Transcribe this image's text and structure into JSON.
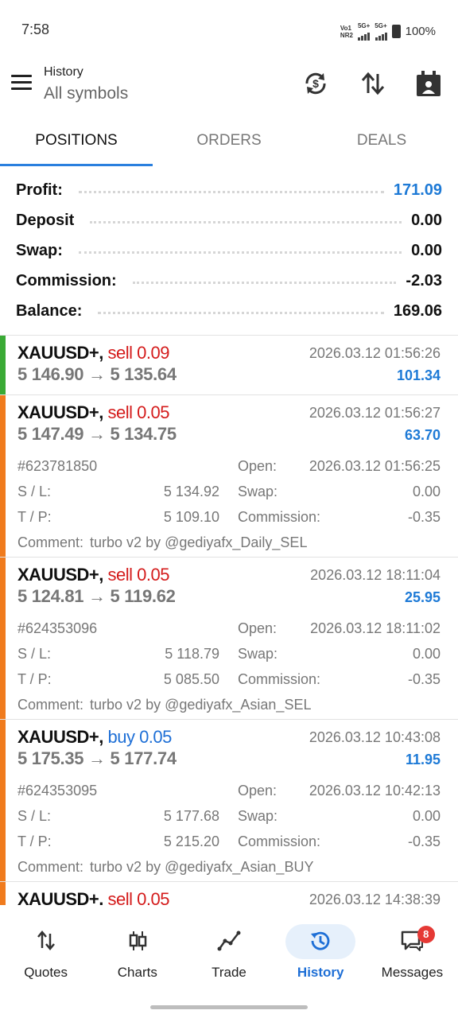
{
  "status_bar": {
    "time": "7:58",
    "net1_top": "Vo1",
    "net1_bottom": "NR2",
    "net2": "5G+",
    "net3": "5G+",
    "battery": "100%"
  },
  "app_bar": {
    "title": "History",
    "subtitle": "All symbols",
    "icons": [
      "menu-icon",
      "currency-refresh-icon",
      "sort-icon",
      "calendar-icon"
    ]
  },
  "tabs": [
    {
      "label": "POSITIONS",
      "active": true
    },
    {
      "label": "ORDERS",
      "active": false
    },
    {
      "label": "DEALS",
      "active": false
    }
  ],
  "summary": [
    {
      "label": "Profit:",
      "value": "171.09"
    },
    {
      "label": "Deposit",
      "value": "0.00"
    },
    {
      "label": "Swap:",
      "value": "0.00"
    },
    {
      "label": "Commission:",
      "value": "-2.03"
    },
    {
      "label": "Balance:",
      "value": "169.06"
    }
  ],
  "colors": {
    "profit_blue": "#1e7ad6",
    "sell_red": "#d41b1b",
    "buy_blue": "#1e6fd6",
    "stripe_green": "#3aaa35",
    "stripe_orange": "#f07b1d"
  },
  "positions": [
    {
      "symbol": "XAUUSD+,",
      "side": "sell 0.09",
      "time": "2026.03.12 01:56:26",
      "prices": "5 146.90 → 5 135.64",
      "profit": "101.34"
    },
    {
      "symbol": "XAUUSD+,",
      "side": "sell 0.05",
      "time": "2026.03.12 01:56:27",
      "prices": "5 147.49 → 5 134.75",
      "profit": "63.70",
      "ticket": "#623781850",
      "open_label": "Open:",
      "open": "2026.03.12 01:56:25",
      "sl_label": "S / L:",
      "sl": "5 134.92",
      "swap_label": "Swap:",
      "swap": "0.00",
      "tp_label": "T / P:",
      "tp": "5 109.10",
      "comm_label": "Commission:",
      "commission": "-0.35",
      "comment_label": "Comment:",
      "comment": "turbo v2 by @gediyafx_Daily_SEL"
    },
    {
      "symbol": "XAUUSD+,",
      "side": "sell 0.05",
      "time": "2026.03.12 18:11:04",
      "prices": "5 124.81 → 5 119.62",
      "profit": "25.95",
      "ticket": "#624353096",
      "open_label": "Open:",
      "open": "2026.03.12 18:11:02",
      "sl_label": "S / L:",
      "sl": "5 118.79",
      "swap_label": "Swap:",
      "swap": "0.00",
      "tp_label": "T / P:",
      "tp": "5 085.50",
      "comm_label": "Commission:",
      "commission": "-0.35",
      "comment_label": "Comment:",
      "comment": "turbo v2 by @gediyafx_Asian_SEL"
    },
    {
      "symbol": "XAUUSD+,",
      "side": "buy 0.05",
      "time": "2026.03.12 10:43:08",
      "prices": "5 175.35 → 5 177.74",
      "profit": "11.95",
      "ticket": "#624353095",
      "open_label": "Open:",
      "open": "2026.03.12 10:42:13",
      "sl_label": "S / L:",
      "sl": "5 177.68",
      "swap_label": "Swap:",
      "swap": "0.00",
      "tp_label": "T / P:",
      "tp": "5 215.20",
      "comm_label": "Commission:",
      "commission": "-0.35",
      "comment_label": "Comment:",
      "comment": "turbo v2 by @gediyafx_Asian_BUY"
    },
    {
      "symbol": "XAUUSD+,",
      "side": "sell 0.05",
      "time": "2026.03.12 14:38:39"
    }
  ],
  "bottom_nav": [
    {
      "label": "Quotes",
      "icon": "arrows-updown-icon"
    },
    {
      "label": "Charts",
      "icon": "candles-icon"
    },
    {
      "label": "Trade",
      "icon": "trend-line-icon"
    },
    {
      "label": "History",
      "icon": "history-clock-icon",
      "active": true
    },
    {
      "label": "Messages",
      "icon": "chat-icon",
      "badge": "8"
    }
  ]
}
